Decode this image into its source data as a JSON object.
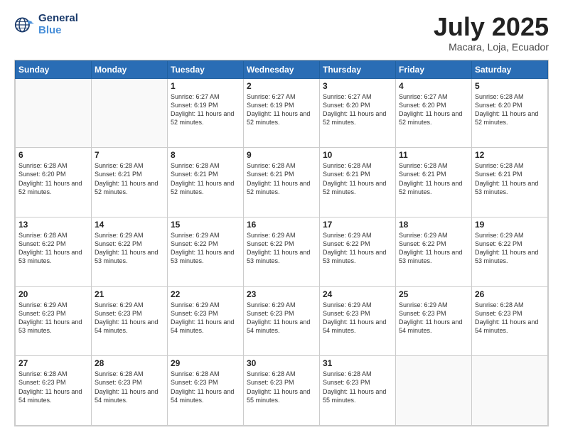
{
  "logo": {
    "line1": "General",
    "line2": "Blue"
  },
  "header": {
    "month": "July 2025",
    "location": "Macara, Loja, Ecuador"
  },
  "weekdays": [
    "Sunday",
    "Monday",
    "Tuesday",
    "Wednesday",
    "Thursday",
    "Friday",
    "Saturday"
  ],
  "weeks": [
    [
      {
        "day": "",
        "info": ""
      },
      {
        "day": "",
        "info": ""
      },
      {
        "day": "1",
        "info": "Sunrise: 6:27 AM\nSunset: 6:19 PM\nDaylight: 11 hours and 52 minutes."
      },
      {
        "day": "2",
        "info": "Sunrise: 6:27 AM\nSunset: 6:19 PM\nDaylight: 11 hours and 52 minutes."
      },
      {
        "day": "3",
        "info": "Sunrise: 6:27 AM\nSunset: 6:20 PM\nDaylight: 11 hours and 52 minutes."
      },
      {
        "day": "4",
        "info": "Sunrise: 6:27 AM\nSunset: 6:20 PM\nDaylight: 11 hours and 52 minutes."
      },
      {
        "day": "5",
        "info": "Sunrise: 6:28 AM\nSunset: 6:20 PM\nDaylight: 11 hours and 52 minutes."
      }
    ],
    [
      {
        "day": "6",
        "info": "Sunrise: 6:28 AM\nSunset: 6:20 PM\nDaylight: 11 hours and 52 minutes."
      },
      {
        "day": "7",
        "info": "Sunrise: 6:28 AM\nSunset: 6:21 PM\nDaylight: 11 hours and 52 minutes."
      },
      {
        "day": "8",
        "info": "Sunrise: 6:28 AM\nSunset: 6:21 PM\nDaylight: 11 hours and 52 minutes."
      },
      {
        "day": "9",
        "info": "Sunrise: 6:28 AM\nSunset: 6:21 PM\nDaylight: 11 hours and 52 minutes."
      },
      {
        "day": "10",
        "info": "Sunrise: 6:28 AM\nSunset: 6:21 PM\nDaylight: 11 hours and 52 minutes."
      },
      {
        "day": "11",
        "info": "Sunrise: 6:28 AM\nSunset: 6:21 PM\nDaylight: 11 hours and 52 minutes."
      },
      {
        "day": "12",
        "info": "Sunrise: 6:28 AM\nSunset: 6:21 PM\nDaylight: 11 hours and 53 minutes."
      }
    ],
    [
      {
        "day": "13",
        "info": "Sunrise: 6:28 AM\nSunset: 6:22 PM\nDaylight: 11 hours and 53 minutes."
      },
      {
        "day": "14",
        "info": "Sunrise: 6:29 AM\nSunset: 6:22 PM\nDaylight: 11 hours and 53 minutes."
      },
      {
        "day": "15",
        "info": "Sunrise: 6:29 AM\nSunset: 6:22 PM\nDaylight: 11 hours and 53 minutes."
      },
      {
        "day": "16",
        "info": "Sunrise: 6:29 AM\nSunset: 6:22 PM\nDaylight: 11 hours and 53 minutes."
      },
      {
        "day": "17",
        "info": "Sunrise: 6:29 AM\nSunset: 6:22 PM\nDaylight: 11 hours and 53 minutes."
      },
      {
        "day": "18",
        "info": "Sunrise: 6:29 AM\nSunset: 6:22 PM\nDaylight: 11 hours and 53 minutes."
      },
      {
        "day": "19",
        "info": "Sunrise: 6:29 AM\nSunset: 6:22 PM\nDaylight: 11 hours and 53 minutes."
      }
    ],
    [
      {
        "day": "20",
        "info": "Sunrise: 6:29 AM\nSunset: 6:23 PM\nDaylight: 11 hours and 53 minutes."
      },
      {
        "day": "21",
        "info": "Sunrise: 6:29 AM\nSunset: 6:23 PM\nDaylight: 11 hours and 54 minutes."
      },
      {
        "day": "22",
        "info": "Sunrise: 6:29 AM\nSunset: 6:23 PM\nDaylight: 11 hours and 54 minutes."
      },
      {
        "day": "23",
        "info": "Sunrise: 6:29 AM\nSunset: 6:23 PM\nDaylight: 11 hours and 54 minutes."
      },
      {
        "day": "24",
        "info": "Sunrise: 6:29 AM\nSunset: 6:23 PM\nDaylight: 11 hours and 54 minutes."
      },
      {
        "day": "25",
        "info": "Sunrise: 6:29 AM\nSunset: 6:23 PM\nDaylight: 11 hours and 54 minutes."
      },
      {
        "day": "26",
        "info": "Sunrise: 6:28 AM\nSunset: 6:23 PM\nDaylight: 11 hours and 54 minutes."
      }
    ],
    [
      {
        "day": "27",
        "info": "Sunrise: 6:28 AM\nSunset: 6:23 PM\nDaylight: 11 hours and 54 minutes."
      },
      {
        "day": "28",
        "info": "Sunrise: 6:28 AM\nSunset: 6:23 PM\nDaylight: 11 hours and 54 minutes."
      },
      {
        "day": "29",
        "info": "Sunrise: 6:28 AM\nSunset: 6:23 PM\nDaylight: 11 hours and 54 minutes."
      },
      {
        "day": "30",
        "info": "Sunrise: 6:28 AM\nSunset: 6:23 PM\nDaylight: 11 hours and 55 minutes."
      },
      {
        "day": "31",
        "info": "Sunrise: 6:28 AM\nSunset: 6:23 PM\nDaylight: 11 hours and 55 minutes."
      },
      {
        "day": "",
        "info": ""
      },
      {
        "day": "",
        "info": ""
      }
    ]
  ]
}
